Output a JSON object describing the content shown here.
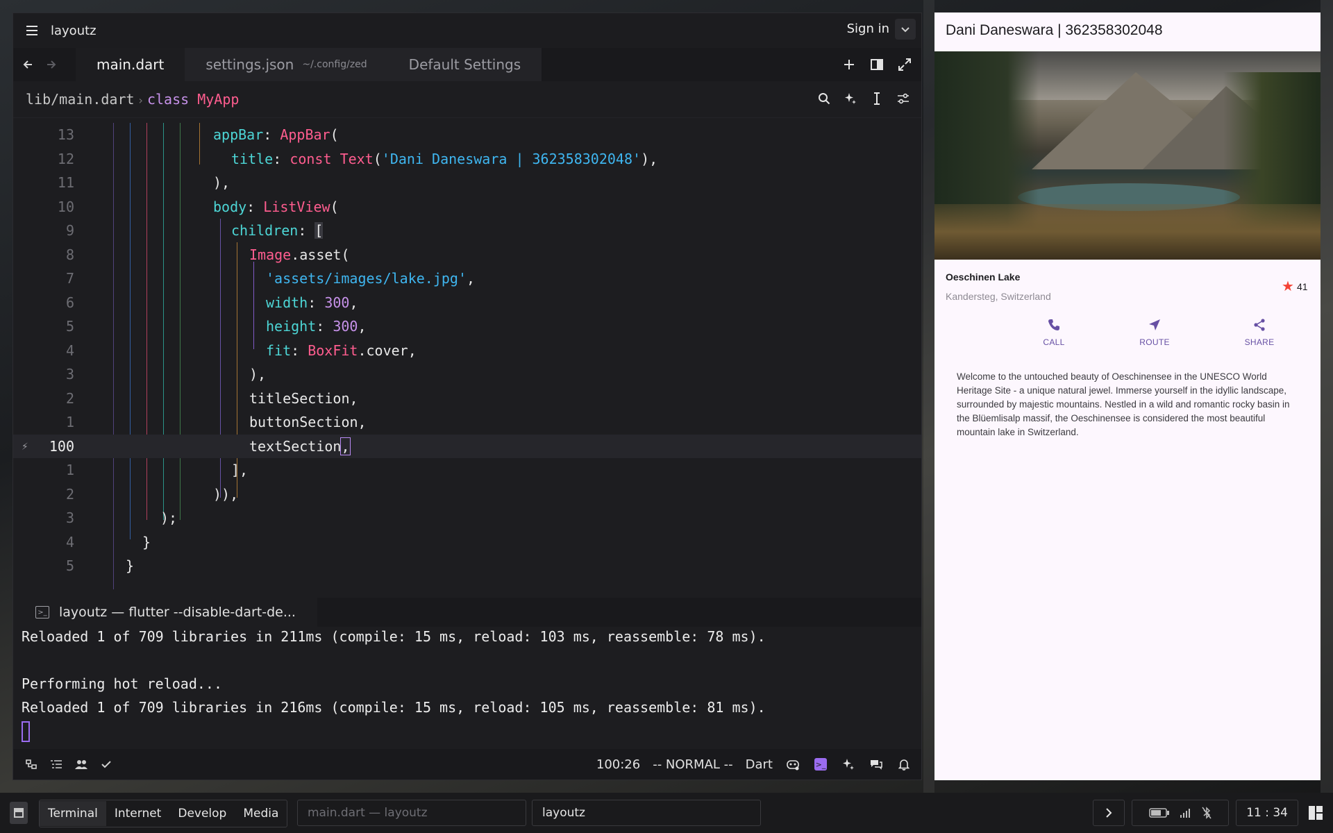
{
  "titlebar": {
    "project": "layoutz",
    "sign_in": "Sign in"
  },
  "tabs": [
    {
      "label": "main.dart",
      "sub": ""
    },
    {
      "label": "settings.json",
      "sub": "~/.config/zed"
    },
    {
      "label": "Default Settings",
      "sub": ""
    }
  ],
  "breadcrumb": {
    "path": "lib/main.dart",
    "keyword": "class",
    "class_name": "MyApp"
  },
  "code": {
    "line_numbers": [
      "13",
      "12",
      "11",
      "10",
      "9",
      "8",
      "7",
      "6",
      "5",
      "4",
      "3",
      "2",
      "1",
      "100",
      "1",
      "2",
      "3",
      "4",
      "5"
    ],
    "line1": [
      "appBar",
      ": ",
      "AppBar",
      "("
    ],
    "line2": [
      "title",
      ": ",
      "const ",
      "Text",
      "(",
      "'Dani Daneswara | 362358302048'",
      "),"
    ],
    "line3": "),",
    "line4": [
      "body",
      ": ",
      "ListView",
      "("
    ],
    "line5": [
      "children",
      ": ",
      "["
    ],
    "line6": [
      "Image",
      ".asset("
    ],
    "line7": [
      "'assets/images/lake.jpg'",
      ","
    ],
    "line8": [
      "width",
      ": ",
      "300",
      ","
    ],
    "line9": [
      "height",
      ": ",
      "300",
      ","
    ],
    "line10": [
      "fit",
      ": ",
      "BoxFit",
      ".cover,"
    ],
    "line11": "),",
    "line12": "titleSection,",
    "line13": "buttonSection,",
    "line14": [
      "textSection",
      ","
    ],
    "line15": "],",
    "line16": ")),",
    "line17": ");",
    "line18": "}",
    "line19": "}"
  },
  "terminal": {
    "tab_label": "layoutz — flutter --disable-dart-de...",
    "lines": [
      "Reloaded 1 of 709 libraries in 211ms (compile: 15 ms, reload: 103 ms, reassemble: 78 ms).",
      "",
      "Performing hot reload...",
      "Reloaded 1 of 709 libraries in 216ms (compile: 15 ms, reload: 105 ms, reassemble: 81 ms)."
    ]
  },
  "statusbar": {
    "cursor_pos": "100:26",
    "mode": "-- NORMAL --",
    "language": "Dart"
  },
  "preview": {
    "app_title": "Dani Daneswara | 362358302048",
    "location_title": "Oeschinen Lake",
    "location_sub": "Kandersteg, Switzerland",
    "stars": "41",
    "actions": [
      "CALL",
      "ROUTE",
      "SHARE"
    ],
    "description": "Welcome to the untouched beauty of Oeschinensee in the UNESCO World Heritage Site - a unique natural jewel. Immerse yourself in the idyllic landscape, surrounded by majestic mountains. Nestled in a wild and romantic rocky basin in the Blüemlisalp massif, the Oeschinensee is considered the most beautiful mountain lake in Switzerland.",
    "accent_color": "#6750a4",
    "star_color": "#f44336"
  },
  "taskbar": {
    "workspaces": [
      "Terminal",
      "Internet",
      "Develop",
      "Media"
    ],
    "windows": [
      "main.dart — layoutz",
      "layoutz"
    ],
    "clock": "11 : 34"
  }
}
